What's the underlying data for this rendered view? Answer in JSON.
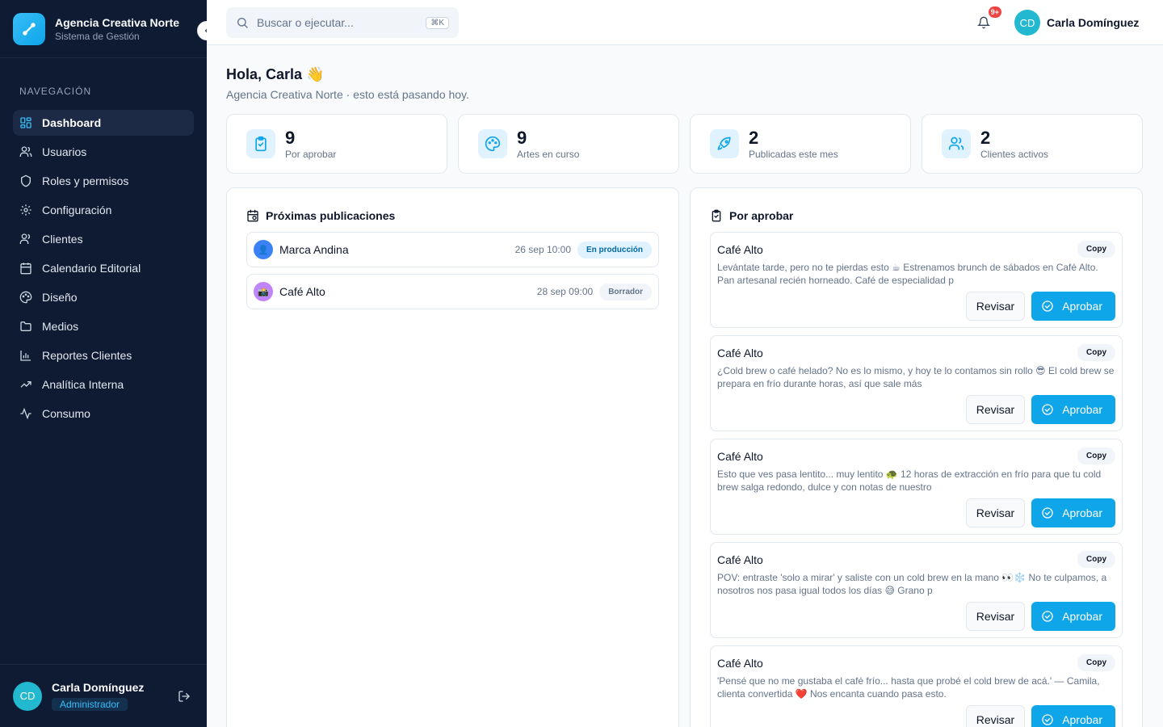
{
  "brand": {
    "name": "Agencia Creativa Norte",
    "subtitle": "Sistema de Gestión"
  },
  "sidebar": {
    "heading": "NAVEGACIÓN",
    "items": [
      {
        "label": "Dashboard",
        "icon": "dashboard-icon",
        "active": true
      },
      {
        "label": "Usuarios",
        "icon": "users-icon"
      },
      {
        "label": "Roles y permisos",
        "icon": "shield-icon"
      },
      {
        "label": "Configuración",
        "icon": "gear-icon"
      },
      {
        "label": "Clientes",
        "icon": "clients-icon"
      },
      {
        "label": "Calendario Editorial",
        "icon": "calendar-icon"
      },
      {
        "label": "Diseño",
        "icon": "palette-icon"
      },
      {
        "label": "Medios",
        "icon": "folder-icon"
      },
      {
        "label": "Reportes Clientes",
        "icon": "bar-chart-icon"
      },
      {
        "label": "Analítica Interna",
        "icon": "trending-icon"
      },
      {
        "label": "Consumo",
        "icon": "activity-icon"
      }
    ],
    "user": {
      "initials": "CD",
      "name": "Carla Domínguez",
      "role": "Administrador"
    }
  },
  "header": {
    "search_placeholder": "Buscar o ejecutar...",
    "shortcut": "⌘K",
    "notifications_badge": "9+",
    "user_initials": "CD",
    "user_name": "Carla Domínguez"
  },
  "main": {
    "greeting": "Hola, Carla 👋",
    "subtitle": "Agencia Creativa Norte · esto está pasando hoy.",
    "stats": [
      {
        "value": "9",
        "label": "Por aprobar",
        "icon": "clipboard-check-icon"
      },
      {
        "value": "9",
        "label": "Artes en curso",
        "icon": "palette-icon"
      },
      {
        "value": "2",
        "label": "Publicadas este mes",
        "icon": "rocket-icon"
      },
      {
        "value": "2",
        "label": "Clientes activos",
        "icon": "users-icon"
      }
    ],
    "upcoming": {
      "title": "Próximas publicaciones",
      "items": [
        {
          "name": "Marca Andina",
          "date": "26 sep 10:00",
          "status": "En producción",
          "avatar": "👤"
        },
        {
          "name": "Café Alto",
          "date": "28 sep 09:00",
          "status": "Borrador",
          "avatar": "📸"
        }
      ]
    },
    "approvals": {
      "title": "Por aprobar",
      "review_label": "Revisar",
      "approve_label": "Aprobar",
      "chip": "Copy",
      "items": [
        {
          "name": "Café Alto",
          "text": "Levántate tarde, pero no te pierdas esto ☕ Estrenamos brunch de sábados en Café Alto. Pan artesanal recién horneado. Café de especialidad p"
        },
        {
          "name": "Café Alto",
          "text": "¿Cold brew o café helado? No es lo mismo, y hoy te lo contamos sin rollo 😎 El cold brew se prepara en frío durante horas, así que sale más"
        },
        {
          "name": "Café Alto",
          "text": "Esto que ves pasa lentito... muy lentito 🐢 12 horas de extracción en frío para que tu cold brew salga redondo, dulce y con notas de nuestro"
        },
        {
          "name": "Café Alto",
          "text": "POV: entraste 'solo a mirar' y saliste con un cold brew en la mano 👀❄️ No te culpamos, a nosotros nos pasa igual todos los días 😅 Grano p"
        },
        {
          "name": "Café Alto",
          "text": "'Pensé que no me gustaba el café frío... hasta que probé el cold brew de acá.' — Camila, clienta convertida ❤️ Nos encanta cuando pasa esto."
        }
      ]
    }
  }
}
